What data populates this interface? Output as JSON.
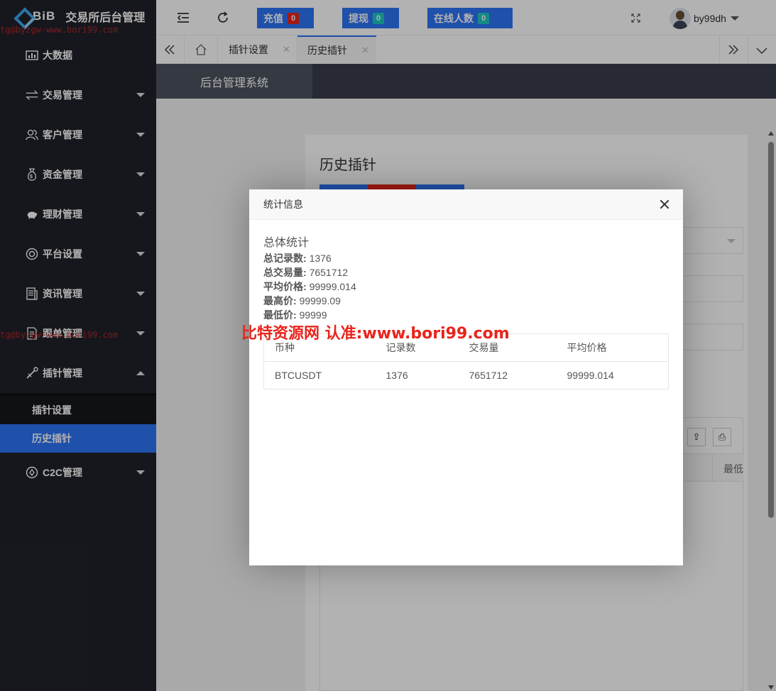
{
  "app": {
    "brand": "BiB",
    "title": "交易所后台管理"
  },
  "watermarks": {
    "side_top": "tg@byzgw-www.bori99.com",
    "side_mid": "tg@byzgw-www.bori99.com",
    "center": "比特资源网 认准:www.bori99.com"
  },
  "sidebar": {
    "items": [
      {
        "label": "大数据",
        "icon": "bar-chart-icon"
      },
      {
        "label": "交易管理",
        "icon": "exchange-icon"
      },
      {
        "label": "客户管理",
        "icon": "users-icon"
      },
      {
        "label": "资金管理",
        "icon": "money-bag-icon"
      },
      {
        "label": "理财管理",
        "icon": "piggy-bank-icon"
      },
      {
        "label": "平台设置",
        "icon": "target-icon"
      },
      {
        "label": "资讯管理",
        "icon": "news-icon"
      },
      {
        "label": "跟单管理",
        "icon": "document-icon"
      },
      {
        "label": "插针管理",
        "icon": "needle-icon"
      }
    ],
    "sub_items": [
      {
        "label": "插针设置"
      },
      {
        "label": "历史插针"
      }
    ],
    "last_item": {
      "label": "C2C管理",
      "icon": "c2c-icon"
    }
  },
  "header": {
    "recharge": {
      "label": "充值",
      "count": "0",
      "badge_color": "#e8241c"
    },
    "withdraw": {
      "label": "提现",
      "count": "0",
      "badge_color": "#1cc7c2"
    },
    "online": {
      "label": "在线人数",
      "count": "0",
      "badge_color": "#1cc7c2"
    },
    "username": "by99dh"
  },
  "tabs": [
    {
      "label": "插针设置"
    },
    {
      "label": "历史插针"
    }
  ],
  "subnav": {
    "label": "后台管理系统"
  },
  "page": {
    "title": "历史插针",
    "partial_column": "最低"
  },
  "modal": {
    "title": "统计信息",
    "summary_title": "总体统计",
    "stats": [
      {
        "label": "总记录数:",
        "value": "1376"
      },
      {
        "label": "总交易量:",
        "value": "7651712"
      },
      {
        "label": "平均价格:",
        "value": "99999.014"
      },
      {
        "label": "最高价:",
        "value": "99999.09"
      },
      {
        "label": "最低价:",
        "value": "99999"
      }
    ],
    "table": {
      "headers": [
        "币种",
        "记录数",
        "交易量",
        "平均价格"
      ],
      "rows": [
        [
          "BTCUSDT",
          "1376",
          "7651712",
          "99999.014"
        ]
      ]
    }
  },
  "colors": {
    "accent": "#2d74f5",
    "sidebar": "#20222a",
    "danger": "#e8241c"
  }
}
